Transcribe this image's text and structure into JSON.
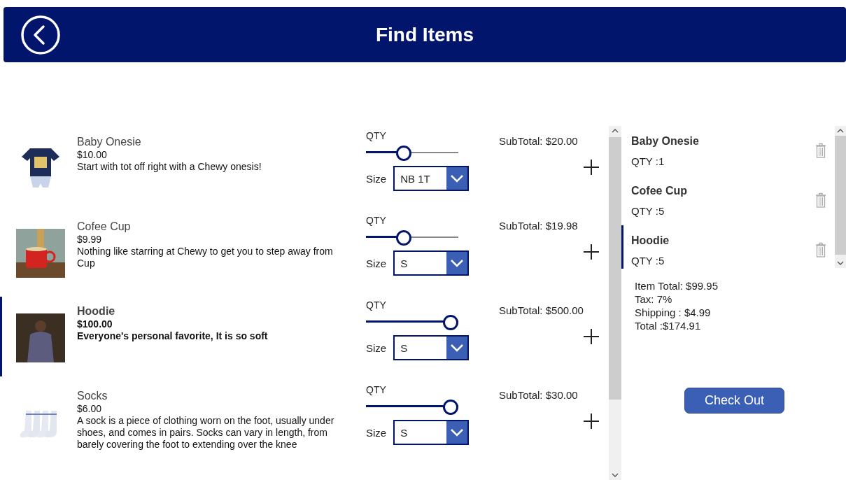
{
  "header": {
    "title": "Find Items"
  },
  "products": [
    {
      "name": "Baby Onesie",
      "price": "$10.00",
      "description": "Start with tot off right with a Chewy onesis!",
      "selected": false,
      "qty_label": "QTY",
      "level": 0.39,
      "size_label": "Size",
      "size": "NB 1T",
      "subtotal": "SubTotal: $20.00"
    },
    {
      "name": "Cofee Cup",
      "price": "$9.99",
      "description": "Nothing like starring at Chewy to get you to step away from Cup",
      "selected": false,
      "qty_label": "QTY",
      "level": 0.39,
      "size_label": "Size",
      "size": "S",
      "subtotal": "SubTotal: $19.98"
    },
    {
      "name": "Hoodie",
      "price": "$100.00",
      "description": "Everyone's personal favorite, It is so soft",
      "selected": true,
      "qty_label": "QTY",
      "level": 1,
      "size_label": "Size",
      "size": "S",
      "subtotal": "SubTotal: $500.00"
    },
    {
      "name": "Socks",
      "price": "$6.00",
      "description": "A sock is a piece of clothing worn on the foot, usually under shoes, and comes in pairs. Socks can vary in length, from barely covering the foot to extending over the knee",
      "selected": false,
      "qty_label": "QTY",
      "level": 1,
      "size_label": "Size",
      "size": "S",
      "subtotal": "SubTotal: $30.00"
    }
  ],
  "cart": {
    "items": [
      {
        "name": "Baby Onesie",
        "qty": "QTY :1",
        "selected": false
      },
      {
        "name": "Cofee Cup",
        "qty": "QTY :5",
        "selected": false
      },
      {
        "name": "Hoodie",
        "qty": "QTY :5",
        "selected": true
      }
    ],
    "totals": [
      "Item Total: $99.95",
      "Tax: 7%",
      "Shipping : $4.99",
      "Total :$174.91"
    ],
    "checkout_button": "Check Out"
  }
}
